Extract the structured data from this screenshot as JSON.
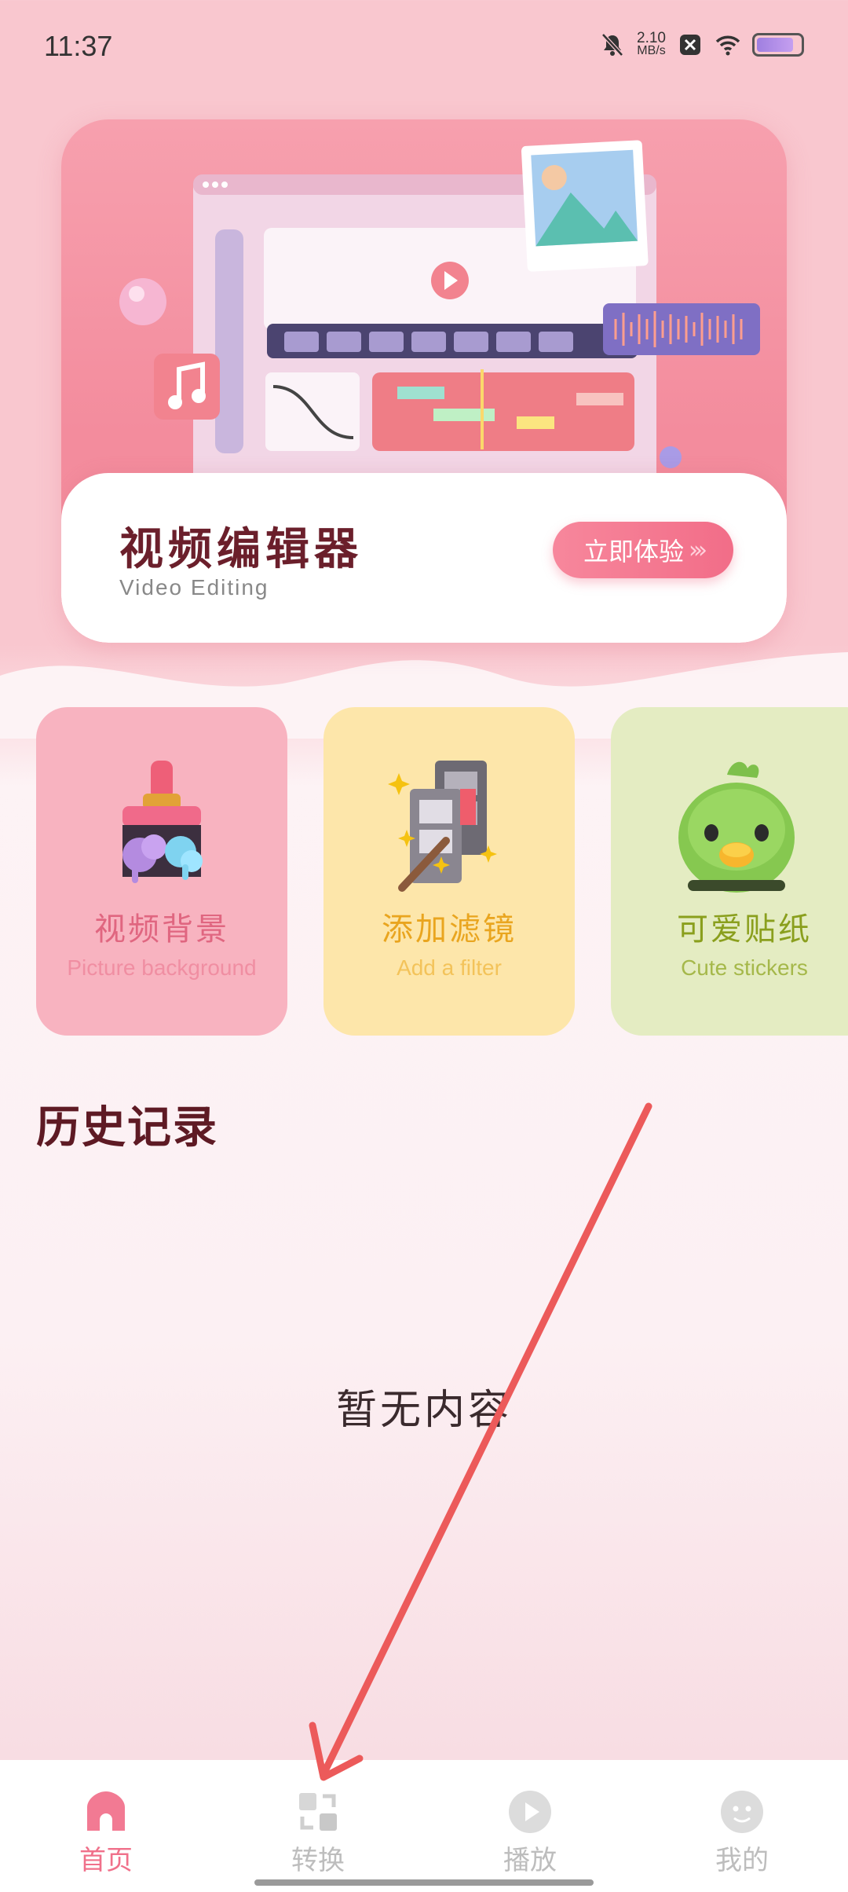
{
  "status_bar": {
    "time": "11:37",
    "net_speed_value": "2.10",
    "net_speed_unit": "MB/s",
    "battery_level": 0.85
  },
  "banner": {
    "title": "视频编辑器",
    "subtitle": "Video Editing",
    "button_label": "立即体验",
    "button_arrows": "›››"
  },
  "features": [
    {
      "title": "视频背景",
      "subtitle": "Picture background",
      "icon": "paint-brush-icon"
    },
    {
      "title": "添加滤镜",
      "subtitle": "Add a filter",
      "icon": "film-wand-icon"
    },
    {
      "title": "可爱贴纸",
      "subtitle": "Cute stickers",
      "icon": "green-bird-icon"
    }
  ],
  "history": {
    "title": "历史记录",
    "empty_text": "暂无内容"
  },
  "nav": {
    "items": [
      {
        "label": "首页",
        "icon": "home-icon",
        "active": true
      },
      {
        "label": "转换",
        "icon": "convert-icon",
        "active": false
      },
      {
        "label": "播放",
        "icon": "play-icon",
        "active": false
      },
      {
        "label": "我的",
        "icon": "profile-icon",
        "active": false
      }
    ]
  },
  "colors": {
    "accent": "#f0708a",
    "background_top": "#f9c7cf",
    "annotation_arrow": "#ec5a5a"
  }
}
